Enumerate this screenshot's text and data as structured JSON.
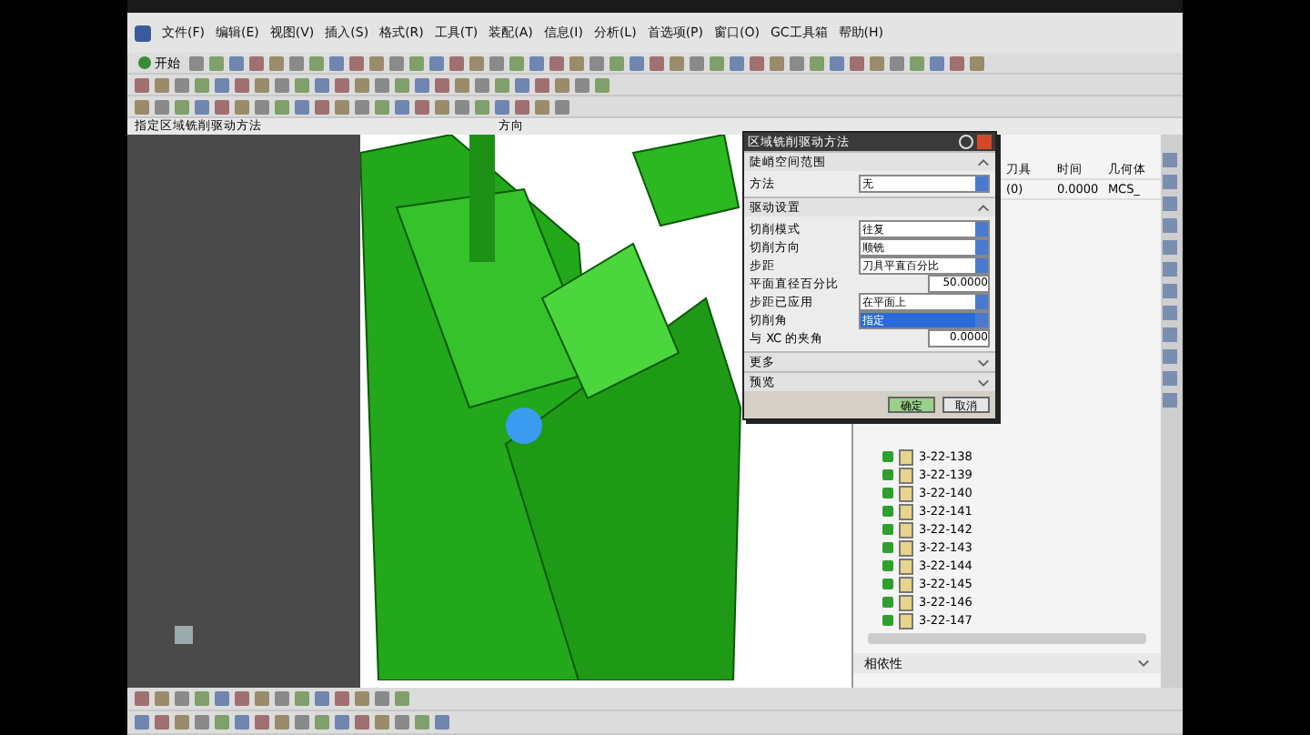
{
  "menu": [
    {
      "label": "文件(F)"
    },
    {
      "label": "编辑(E)"
    },
    {
      "label": "视图(V)"
    },
    {
      "label": "插入(S)"
    },
    {
      "label": "格式(R)"
    },
    {
      "label": "工具(T)"
    },
    {
      "label": "装配(A)"
    },
    {
      "label": "信息(I)"
    },
    {
      "label": "分析(L)"
    },
    {
      "label": "首选项(P)"
    },
    {
      "label": "窗口(O)"
    },
    {
      "label": "GC工具箱"
    },
    {
      "label": "帮助(H)"
    }
  ],
  "toolbar": {
    "start_label": "开始"
  },
  "prompt": {
    "text": "指定区域铣削驱动方法",
    "status": "方向"
  },
  "dialog": {
    "title": "区域铣削驱动方法",
    "sections": [
      {
        "title": "陡峭空间范围",
        "expanded": true,
        "rows": [
          {
            "kind": "select",
            "label": "方法",
            "value": "无",
            "focused": false
          }
        ]
      },
      {
        "title": "驱动设置",
        "expanded": true,
        "rows": [
          {
            "kind": "select",
            "label": "切削模式",
            "value": "往复",
            "focused": false
          },
          {
            "kind": "select",
            "label": "切削方向",
            "value": "顺铣",
            "focused": false
          },
          {
            "kind": "select",
            "label": "步距",
            "value": "刀具平直百分比",
            "focused": false
          },
          {
            "kind": "number",
            "label": "平面直径百分比",
            "value": "50.0000"
          },
          {
            "kind": "select",
            "label": "步距已应用",
            "value": "在平面上",
            "focused": false
          },
          {
            "kind": "select",
            "label": "切削角",
            "value": "指定",
            "focused": true
          },
          {
            "kind": "number",
            "label": "与 XC 的夹角",
            "value": "0.0000"
          }
        ]
      },
      {
        "title": "更多",
        "expanded": false
      },
      {
        "title": "预览",
        "expanded": false
      }
    ],
    "buttons": [
      {
        "label": "确定",
        "default": true
      },
      {
        "label": "取消",
        "default": false
      }
    ]
  },
  "navigator": {
    "columns": [
      "刀具",
      "时间",
      "几何体"
    ],
    "header_row": [
      "(0)",
      "0.0000",
      "MCS_"
    ],
    "operations": [
      {
        "name": "3-22-138",
        "done": true
      },
      {
        "name": "3-22-139",
        "done": true
      },
      {
        "name": "3-22-140",
        "done": true
      },
      {
        "name": "3-22-141",
        "done": true
      },
      {
        "name": "3-22-142",
        "done": true
      },
      {
        "name": "3-22-143",
        "done": true
      },
      {
        "name": "3-22-144",
        "done": true
      },
      {
        "name": "3-22-145",
        "done": true
      },
      {
        "name": "3-22-146",
        "done": true
      },
      {
        "name": "3-22-147",
        "done": true
      }
    ],
    "details": {
      "title": "相依性",
      "expanded": false
    }
  }
}
